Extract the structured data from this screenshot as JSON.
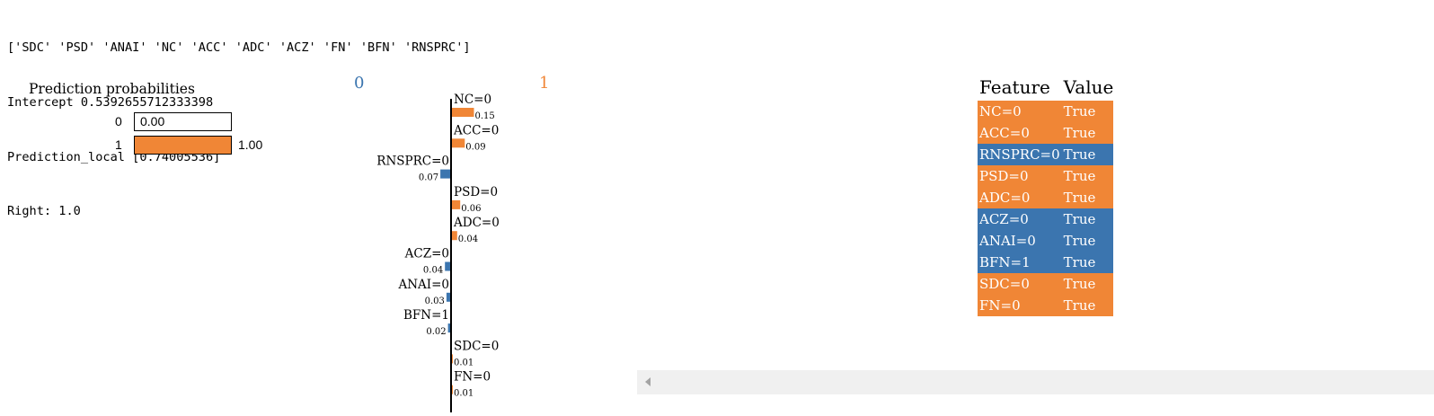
{
  "console": {
    "lines": [
      "['SDC' 'PSD' 'ANAI' 'NC' 'ACC' 'ADC' 'ACZ' 'FN' 'BFN' 'RNSPRC']",
      "Intercept 0.5392655712333398",
      "Prediction_local [0.74005536]",
      "Right: 1.0"
    ]
  },
  "colors": {
    "positive": "#f08636",
    "negative": "#3b75af",
    "axis": "#000000"
  },
  "prediction_probabilities": {
    "title": "Prediction probabilities",
    "rows": [
      {
        "class": "0",
        "value": 0.0,
        "label": "0.00",
        "color": "negative"
      },
      {
        "class": "1",
        "value": 1.0,
        "label": "1.00",
        "color": "positive"
      }
    ]
  },
  "explanation": {
    "class_left": "0",
    "class_right": "1",
    "features": [
      {
        "name": "NC=0",
        "weight": 0.15,
        "label": "0.15",
        "side": "positive"
      },
      {
        "name": "ACC=0",
        "weight": 0.09,
        "label": "0.09",
        "side": "positive"
      },
      {
        "name": "RNSPRC=0",
        "weight": 0.07,
        "label": "0.07",
        "side": "negative"
      },
      {
        "name": "PSD=0",
        "weight": 0.06,
        "label": "0.06",
        "side": "positive"
      },
      {
        "name": "ADC=0",
        "weight": 0.04,
        "label": "0.04",
        "side": "positive"
      },
      {
        "name": "ACZ=0",
        "weight": 0.04,
        "label": "0.04",
        "side": "negative"
      },
      {
        "name": "ANAI=0",
        "weight": 0.03,
        "label": "0.03",
        "side": "negative"
      },
      {
        "name": "BFN=1",
        "weight": 0.02,
        "label": "0.02",
        "side": "negative"
      },
      {
        "name": "SDC=0",
        "weight": 0.01,
        "label": "0.01",
        "side": "positive"
      },
      {
        "name": "FN=0",
        "weight": 0.01,
        "label": "0.01",
        "side": "positive"
      }
    ]
  },
  "feature_table": {
    "headers": [
      "Feature",
      "Value"
    ],
    "rows": [
      {
        "feature": "NC=0",
        "value": "True",
        "side": "positive"
      },
      {
        "feature": "ACC=0",
        "value": "True",
        "side": "positive"
      },
      {
        "feature": "RNSPRC=0",
        "value": "True",
        "side": "negative"
      },
      {
        "feature": "PSD=0",
        "value": "True",
        "side": "positive"
      },
      {
        "feature": "ADC=0",
        "value": "True",
        "side": "positive"
      },
      {
        "feature": "ACZ=0",
        "value": "True",
        "side": "negative"
      },
      {
        "feature": "ANAI=0",
        "value": "True",
        "side": "negative"
      },
      {
        "feature": "BFN=1",
        "value": "True",
        "side": "negative"
      },
      {
        "feature": "SDC=0",
        "value": "True",
        "side": "positive"
      },
      {
        "feature": "FN=0",
        "value": "True",
        "side": "positive"
      }
    ]
  }
}
